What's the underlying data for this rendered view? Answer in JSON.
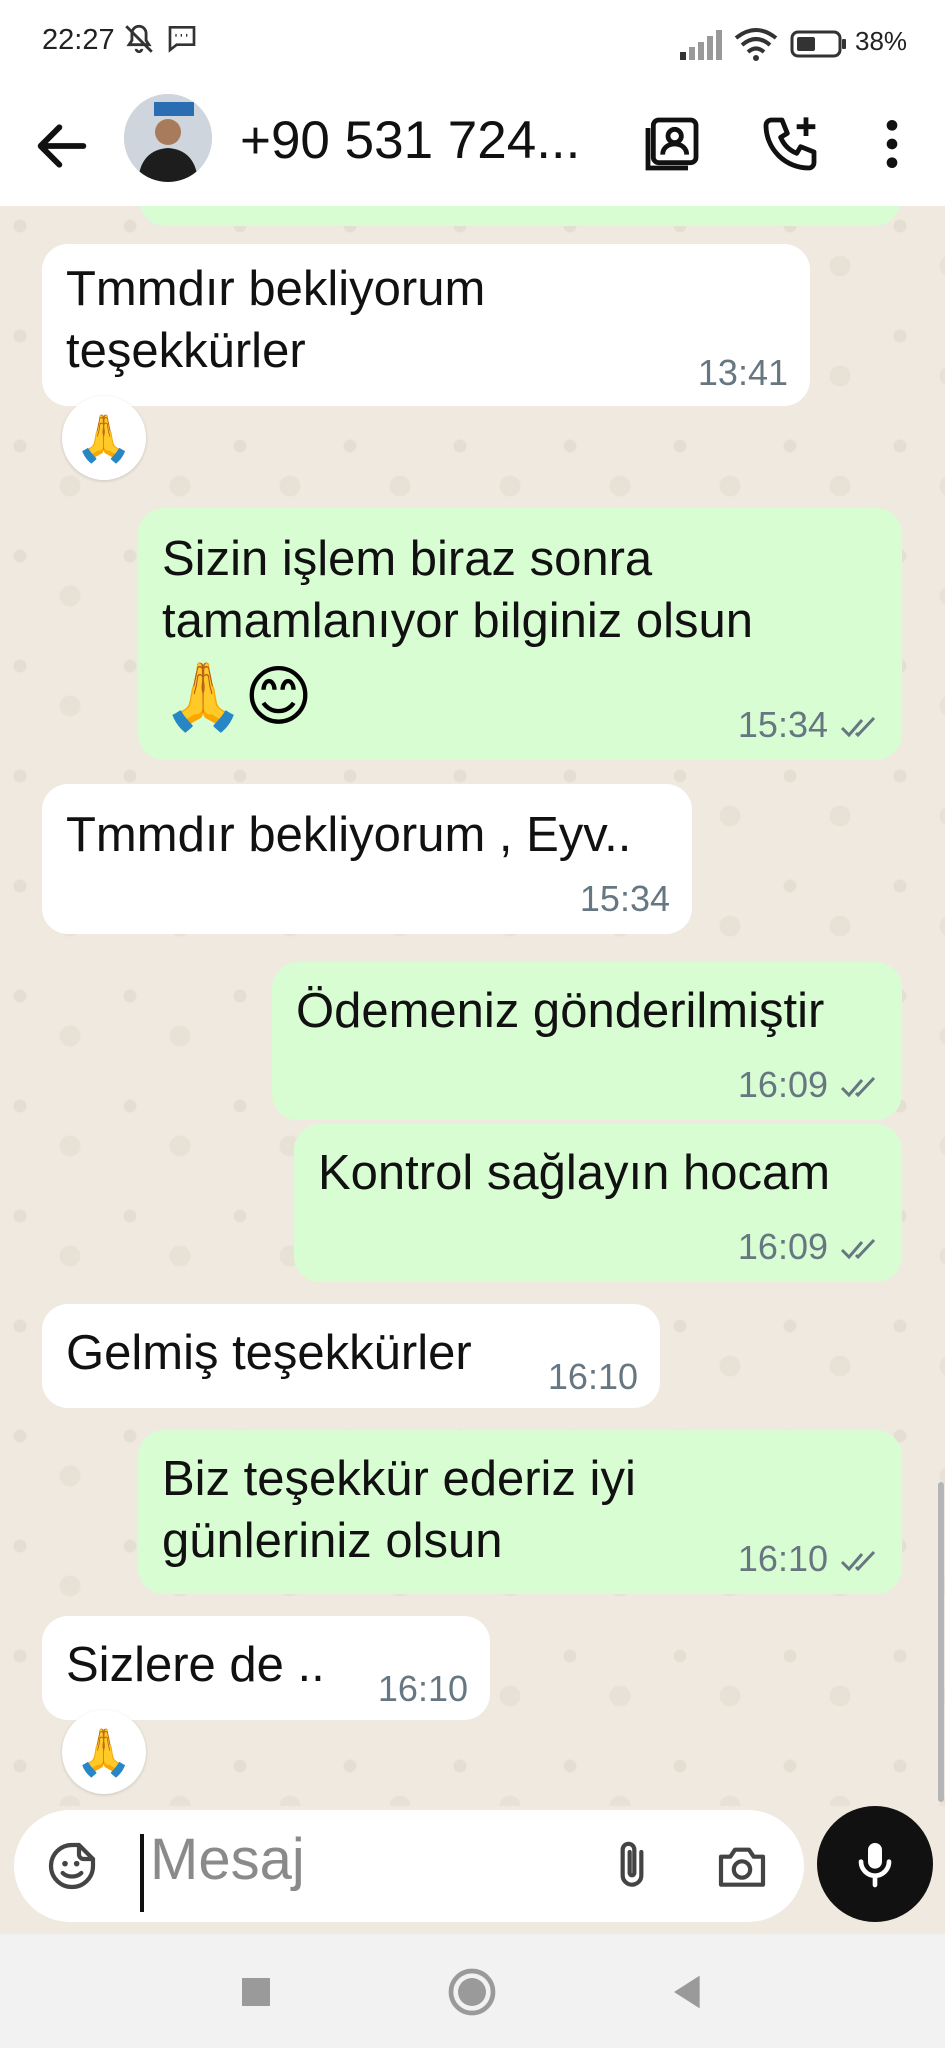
{
  "status_bar": {
    "time": "22:27",
    "battery": "38%"
  },
  "header": {
    "title": "+90 531 724..."
  },
  "messages": [
    {
      "side": "in",
      "lines": [
        "Tmmdır bekliyorum",
        "teşekkürler"
      ],
      "time": "13:41",
      "reaction": "🙏"
    },
    {
      "side": "out",
      "lines": [
        "Sizin işlem biraz sonra",
        "tamamlanıyor bilginiz olsun"
      ],
      "emojis": "🙏😊",
      "time": "15:34"
    },
    {
      "side": "in",
      "lines": [
        "Tmmdır bekliyorum , Eyv.."
      ],
      "time": "15:34"
    },
    {
      "side": "out",
      "lines": [
        "Ödemeniz gönderilmiştir"
      ],
      "time": "16:09"
    },
    {
      "side": "out",
      "lines": [
        "Kontrol sağlayın hocam"
      ],
      "time": "16:09"
    },
    {
      "side": "in",
      "lines": [
        "Gelmiş teşekkürler"
      ],
      "time": "16:10"
    },
    {
      "side": "out",
      "lines": [
        "Biz teşekkür ederiz iyi",
        "günleriniz olsun"
      ],
      "time": "16:10"
    },
    {
      "side": "in",
      "lines": [
        "Sizlere de .."
      ],
      "time": "16:10",
      "reaction": "🙏"
    }
  ],
  "composer": {
    "placeholder": "Mesaj"
  },
  "icons": {
    "mute": "bell-off-icon",
    "message": "message-icon",
    "signal": "signal-icon",
    "wifi": "wifi-icon",
    "battery": "battery-icon",
    "back": "back-arrow-icon",
    "contact_card": "contact-card-icon",
    "call": "add-call-icon",
    "menu": "more-vert-icon",
    "sticker": "sticker-icon",
    "attach": "attach-icon",
    "camera": "camera-icon",
    "mic": "mic-icon"
  },
  "colors": {
    "incoming": "#ffffff",
    "outgoing": "#d9fdd3",
    "chat_bg": "#efe9df",
    "ticks": "#667781"
  }
}
